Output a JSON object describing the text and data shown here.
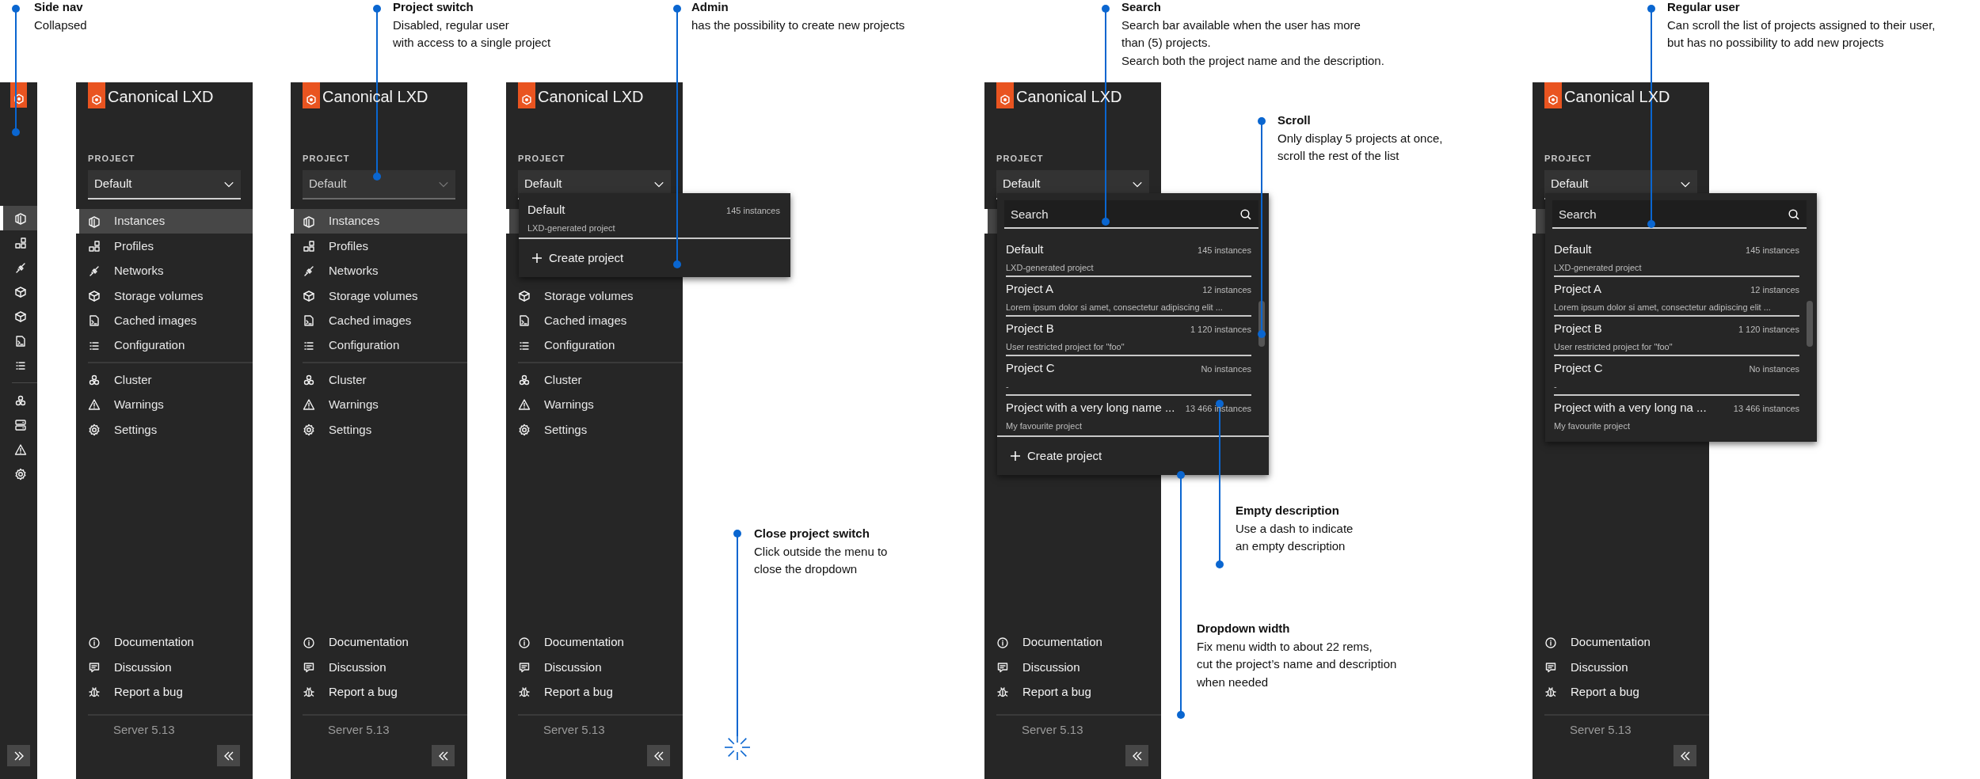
{
  "annotations": [
    {
      "title": "Side nav",
      "lines": [
        "Collapsed"
      ]
    },
    {
      "title": "Project switch",
      "lines": [
        "Disabled, regular user",
        "with access to a single project"
      ]
    },
    {
      "title": "Admin",
      "lines": [
        "has the possibility to create new projects"
      ]
    },
    {
      "title": "Close project switch",
      "lines": [
        "Click outside the menu to",
        "close the dropdown"
      ]
    },
    {
      "title": "Search",
      "lines": [
        "Search bar available when the user has more",
        "than (5) projects.",
        "Search both the project name and the description."
      ]
    },
    {
      "title": "Scroll",
      "lines": [
        "Only display 5 projects at once,",
        "scroll the rest of the list"
      ]
    },
    {
      "title": "Empty description",
      "lines": [
        "Use a dash to indicate",
        "an empty description"
      ]
    },
    {
      "title": "Dropdown width",
      "lines": [
        "Fix menu width to about 22 rems,",
        "cut the project’s name and description",
        "when needed"
      ]
    },
    {
      "title": "Regular user",
      "lines": [
        "Can scroll the list of projects assigned to their user,",
        "but has no possibility to add new projects"
      ]
    }
  ],
  "panels": [
    {
      "kind": "collapsed",
      "nav_items": [
        {
          "selected": true
        },
        {
          "selected": false
        },
        {
          "selected": false
        },
        {
          "selected": false
        },
        {
          "selected": false
        },
        {
          "selected": false
        },
        {
          "selected": false
        }
      ],
      "secondary_items": [
        {
          "selected": false
        },
        {
          "selected": false
        },
        {
          "selected": false
        },
        {
          "selected": false
        }
      ]
    },
    {
      "kind": "expanded",
      "brand": "Canonical LXD",
      "project_label": "PROJECT",
      "project_select": {
        "value": "Default",
        "disabled": false
      },
      "nav_items": [
        {
          "label": "Instances",
          "selected": true
        },
        {
          "label": "Profiles",
          "selected": false
        },
        {
          "label": "Networks",
          "selected": false
        },
        {
          "label": "Storage volumes",
          "selected": false
        },
        {
          "label": "Cached images",
          "selected": false
        },
        {
          "label": "Configuration",
          "selected": false
        }
      ],
      "secondary_items": [
        {
          "label": "Cluster",
          "selected": false
        },
        {
          "label": "Warnings",
          "selected": false
        },
        {
          "label": "Settings",
          "selected": false
        }
      ],
      "footer_items": [
        "Documentation",
        "Discussion",
        "Report a bug"
      ],
      "version": "Server 5.13"
    },
    {
      "kind": "expanded",
      "brand": "Canonical LXD",
      "project_label": "PROJECT",
      "project_select": {
        "value": "Default",
        "disabled": true
      },
      "nav_items": [
        {
          "label": "Instances",
          "selected": true
        },
        {
          "label": "Profiles",
          "selected": false
        },
        {
          "label": "Networks",
          "selected": false
        },
        {
          "label": "Storage volumes",
          "selected": false
        },
        {
          "label": "Cached images",
          "selected": false
        },
        {
          "label": "Configuration",
          "selected": false
        }
      ],
      "secondary_items": [
        {
          "label": "Cluster",
          "selected": false
        },
        {
          "label": "Warnings",
          "selected": false
        },
        {
          "label": "Settings",
          "selected": false
        }
      ],
      "footer_items": [
        "Documentation",
        "Discussion",
        "Report a bug"
      ],
      "version": "Server 5.13"
    },
    {
      "kind": "expanded",
      "brand": "Canonical LXD",
      "project_label": "PROJECT",
      "project_select": {
        "value": "Default",
        "disabled": false
      },
      "nav_items": [
        {
          "label": "Storage volumes",
          "selected": false
        },
        {
          "label": "Cached images",
          "selected": false
        },
        {
          "label": "Configuration",
          "selected": false
        }
      ],
      "secondary_items": [
        {
          "label": "Cluster",
          "selected": false
        },
        {
          "label": "Warnings",
          "selected": false
        },
        {
          "label": "Settings",
          "selected": false
        }
      ],
      "footer_items": [
        "Documentation",
        "Discussion",
        "Report a bug"
      ],
      "version": "Server 5.13",
      "dropdown": {
        "projects": [
          {
            "name": "Default",
            "count": "145 instances",
            "description": "LXD-generated project"
          }
        ],
        "create_label": "Create project"
      }
    },
    {
      "kind": "expanded",
      "brand": "Canonical LXD",
      "project_label": "PROJECT",
      "project_select": {
        "value": "Default",
        "disabled": false
      },
      "footer_items": [
        "Documentation",
        "Discussion",
        "Report a bug"
      ],
      "version": "Server 5.13",
      "dropdown": {
        "search": {
          "placeholder": "Search"
        },
        "scrollable": true,
        "projects": [
          {
            "name": "Default",
            "count": "145 instances",
            "description": "LXD-generated project"
          },
          {
            "name": "Project A",
            "count": "12 instances",
            "description": "Lorem ipsum dolor si amet, consectetur adipiscing elit ..."
          },
          {
            "name": "Project B",
            "count": "1 120 instances",
            "description": "User restricted project for \"foo\""
          },
          {
            "name": "Project C",
            "count": "No instances",
            "description": "-"
          },
          {
            "name": "Project with a very long name ...",
            "count": "13 466 instances",
            "description": "My favourite project"
          }
        ],
        "create_label": "Create project"
      }
    },
    {
      "kind": "expanded",
      "brand": "Canonical LXD",
      "project_label": "PROJECT",
      "project_select": {
        "value": "Default",
        "disabled": false
      },
      "footer_items": [
        "Documentation",
        "Discussion",
        "Report a bug"
      ],
      "version": "Server 5.13",
      "dropdown": {
        "search": {
          "placeholder": "Search"
        },
        "scrollable": true,
        "projects": [
          {
            "name": "Default",
            "count": "145 instances",
            "description": "LXD-generated project"
          },
          {
            "name": "Project A",
            "count": "12 instances",
            "description": "Lorem ipsum dolor si amet, consectetur adipiscing elit ..."
          },
          {
            "name": "Project B",
            "count": "1 120 instances",
            "description": "User restricted project for \"foo\""
          },
          {
            "name": "Project C",
            "count": "No instances",
            "description": "-"
          },
          {
            "name": "Project with a very long na ...",
            "count": "13 466 instances",
            "description": "My favourite project"
          }
        ]
      }
    }
  ]
}
